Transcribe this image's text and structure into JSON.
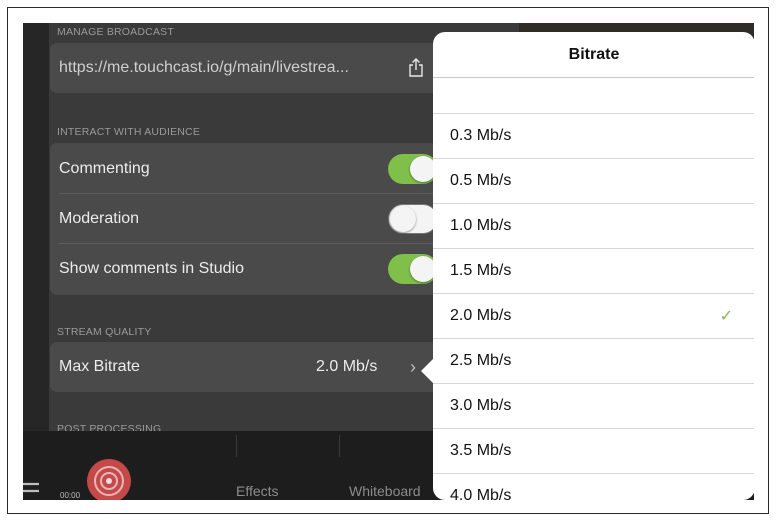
{
  "broadcast": {
    "header": "MANAGE BROADCAST",
    "url": "https://me.touchcast.io/g/main/livestrea..."
  },
  "audience": {
    "header": "INTERACT WITH AUDIENCE",
    "rows": [
      {
        "label": "Commenting",
        "on": true
      },
      {
        "label": "Moderation",
        "on": false
      },
      {
        "label": "Show comments in Studio",
        "on": true
      }
    ]
  },
  "stream_quality": {
    "header": "STREAM QUALITY",
    "max_bitrate_label": "Max Bitrate",
    "max_bitrate_value": "2.0 Mb/s"
  },
  "post_processing_header": "POST PROCESSING",
  "bottom_bar": {
    "timer": "00:00",
    "effects_label": "Effects",
    "whiteboard_label": "Whiteboard"
  },
  "bitrate_popover": {
    "title": "Bitrate",
    "options": [
      "0.3  Mb/s",
      "0.5  Mb/s",
      "1.0  Mb/s",
      "1.5  Mb/s",
      "2.0  Mb/s",
      "2.5  Mb/s",
      "3.0  Mb/s",
      "3.5  Mb/s",
      "4.0  Mb/s"
    ],
    "selected": "2.0  Mb/s",
    "check_glyph": "✓"
  },
  "colors": {
    "toggle_on": "#7fbf4a",
    "panel_bg": "#3a3a3a",
    "card_bg": "#4a4a4a"
  }
}
